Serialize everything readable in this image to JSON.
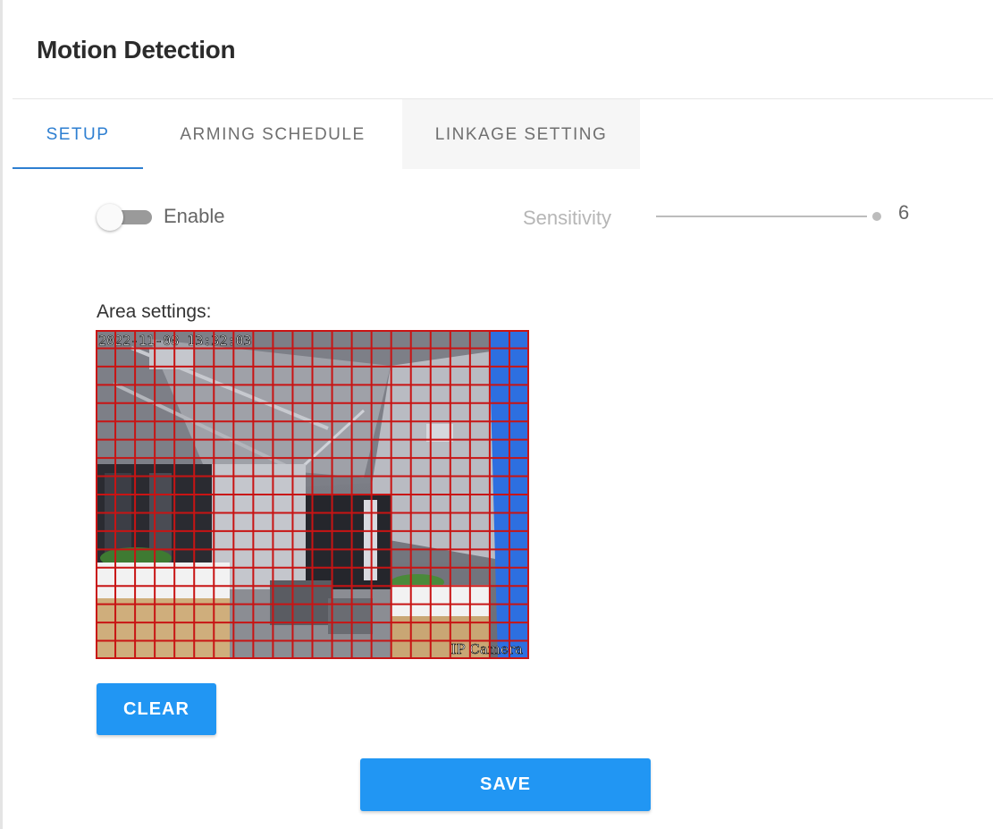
{
  "page": {
    "title": "Motion Detection"
  },
  "tabs": [
    {
      "label": "SETUP",
      "active": true
    },
    {
      "label": "ARMING SCHEDULE",
      "active": false
    },
    {
      "label": "LINKAGE SETTING",
      "active": false
    }
  ],
  "setup": {
    "enable": {
      "label": "Enable",
      "checked": false
    },
    "sensitivity": {
      "label": "Sensitivity",
      "value": "6",
      "min": 0,
      "max": 6
    },
    "area": {
      "label": "Area settings:",
      "grid": {
        "columns": 22,
        "rows": 18,
        "all_cells_selected": true,
        "line_color": "#c81414"
      },
      "overlay_timestamp": "2022-11-08 13:32:03",
      "overlay_camera_name": "IP Camera"
    },
    "clear_label": "CLEAR",
    "save_label": "SAVE"
  },
  "colors": {
    "accent": "#2196f3",
    "tab_active": "#2e7fd1"
  }
}
